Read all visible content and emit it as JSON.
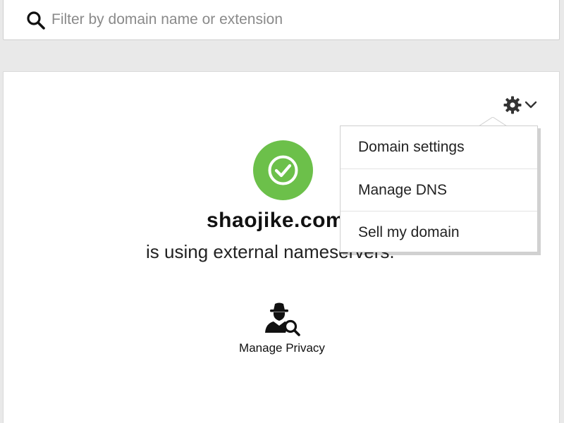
{
  "search": {
    "placeholder": "Filter by domain name or extension",
    "value": ""
  },
  "domain_card": {
    "domain_name": "shaojike.com",
    "status_text": "is using external nameservers.",
    "status_color": "#6cc04a",
    "status_icon": "check-circle-icon",
    "settings_icon": "gear-icon",
    "settings_toggle_icon": "chevron-down-icon",
    "privacy_action": {
      "icon": "detective-search-icon",
      "label": "Manage Privacy"
    }
  },
  "settings_menu": {
    "items": [
      {
        "label": "Domain settings"
      },
      {
        "label": "Manage DNS"
      },
      {
        "label": "Sell my domain"
      }
    ]
  }
}
